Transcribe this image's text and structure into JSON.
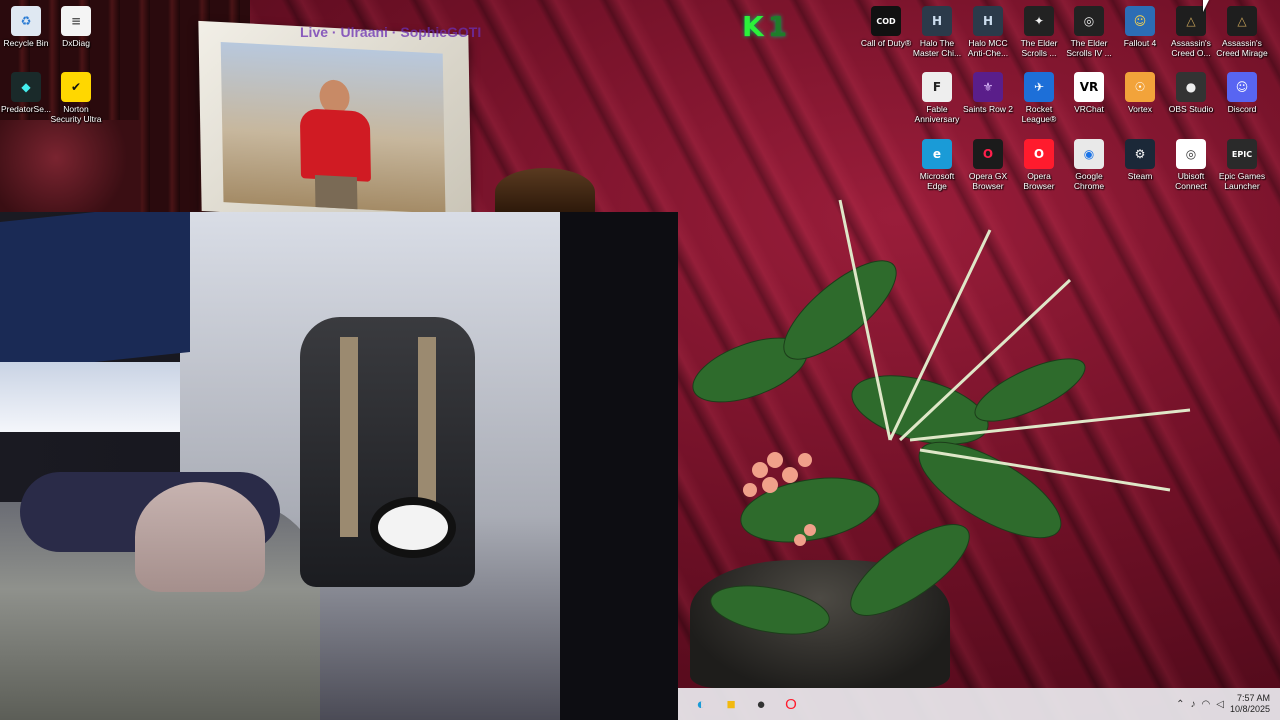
{
  "wallpaper": {
    "overlay_text": "Live · Ulraani · SophieGOTI",
    "logo": {
      "letter": "K",
      "suffix": "1",
      "color": "#2cf03a"
    },
    "colors": {
      "curtain": "#8a1733",
      "deep": "#3b0612"
    }
  },
  "desktop_icons": [
    {
      "label": "Recycle Bin",
      "icon": "recycle-bin-icon",
      "glyph": "♻",
      "bg": "#dfe8f2",
      "fg": "#2a7bd4"
    },
    {
      "label": "DxDiag",
      "icon": "document-icon",
      "glyph": "≡",
      "bg": "#f4f4f4",
      "fg": "#555"
    },
    {
      "label": "PredatorSe...",
      "icon": "predator-icon",
      "glyph": "◆",
      "bg": "#1a2a2a",
      "fg": "#4ee"
    },
    {
      "label": "Norton Security Ultra",
      "icon": "norton-icon",
      "glyph": "✔",
      "bg": "#ffd700",
      "fg": "#111"
    },
    {
      "label": "Call of Duty®",
      "icon": "call-of-duty-icon",
      "glyph": "COD",
      "bg": "#111",
      "fg": "#fff"
    },
    {
      "label": "Halo The Master Chi...",
      "icon": "halo-mcc-icon",
      "glyph": "H",
      "bg": "#2b3a4a",
      "fg": "#cde"
    },
    {
      "label": "Halo MCC Anti-Che...",
      "icon": "halo-anticheat-icon",
      "glyph": "H",
      "bg": "#2b3a4a",
      "fg": "#cde"
    },
    {
      "label": "The Elder Scrolls ...",
      "icon": "elder-scrolls-icon",
      "glyph": "✦",
      "bg": "#222",
      "fg": "#eee"
    },
    {
      "label": "The Elder Scrolls IV ...",
      "icon": "oblivion-icon",
      "glyph": "◎",
      "bg": "#222",
      "fg": "#eee"
    },
    {
      "label": "Fallout 4",
      "icon": "fallout-icon",
      "glyph": "☺",
      "bg": "#2c6db5",
      "fg": "#ffd64a"
    },
    {
      "label": "Assassin's Creed O...",
      "icon": "assassins-creed-icon",
      "glyph": "△",
      "bg": "#1e1e1e",
      "fg": "#c9a45a"
    },
    {
      "label": "Assassin's Creed Mirage",
      "icon": "assassins-creed-mirage-icon",
      "glyph": "△",
      "bg": "#1e1e1e",
      "fg": "#c9a45a"
    },
    {
      "label": "Fable Anniversary",
      "icon": "fable-icon",
      "glyph": "F",
      "bg": "#eee",
      "fg": "#222"
    },
    {
      "label": "Saints Row 2",
      "icon": "saints-row-icon",
      "glyph": "⚜",
      "bg": "#5a1e8a",
      "fg": "#e0c0ff"
    },
    {
      "label": "Rocket League®",
      "icon": "rocket-league-icon",
      "glyph": "✈",
      "bg": "#1d6fd8",
      "fg": "#fff"
    },
    {
      "label": "VRChat",
      "icon": "vrchat-icon",
      "glyph": "VR",
      "bg": "#fff",
      "fg": "#000"
    },
    {
      "label": "Vortex",
      "icon": "vortex-icon",
      "glyph": "☉",
      "bg": "#f2a33a",
      "fg": "#fff"
    },
    {
      "label": "OBS Studio",
      "icon": "obs-icon",
      "glyph": "●",
      "bg": "#333",
      "fg": "#eee"
    },
    {
      "label": "Discord",
      "icon": "discord-icon",
      "glyph": "☺",
      "bg": "#5865f2",
      "fg": "#fff"
    },
    {
      "label": "Microsoft Edge",
      "icon": "edge-icon",
      "glyph": "e",
      "bg": "#1a9bd7",
      "fg": "#fff"
    },
    {
      "label": "Opera GX Browser",
      "icon": "opera-gx-icon",
      "glyph": "O",
      "bg": "#1b1b1b",
      "fg": "#ff1f4b"
    },
    {
      "label": "Opera Browser",
      "icon": "opera-icon",
      "glyph": "O",
      "bg": "#ff1b2d",
      "fg": "#fff"
    },
    {
      "label": "Google Chrome",
      "icon": "chrome-icon",
      "glyph": "◉",
      "bg": "#e9e9e9",
      "fg": "#1a73e8"
    },
    {
      "label": "Steam",
      "icon": "steam-icon",
      "glyph": "⚙",
      "bg": "#1b2838",
      "fg": "#fff"
    },
    {
      "label": "Ubisoft Connect",
      "icon": "ubisoft-icon",
      "glyph": "◎",
      "bg": "#fff",
      "fg": "#333"
    },
    {
      "label": "Epic Games Launcher",
      "icon": "epic-games-icon",
      "glyph": "EPIC",
      "bg": "#2a2a2a",
      "fg": "#fff"
    }
  ],
  "taskbar": {
    "apps": [
      {
        "name": "edge",
        "glyph": "◐",
        "color": "#1a9bd7"
      },
      {
        "name": "file-explorer",
        "glyph": "■",
        "color": "#f2b90f"
      },
      {
        "name": "obs",
        "glyph": "●",
        "color": "#333"
      },
      {
        "name": "opera",
        "glyph": "O",
        "color": "#ff1b2d"
      }
    ],
    "tray": {
      "chevron": "⌃",
      "mic": "♪",
      "wifi": "◠",
      "volume": "◁",
      "time": "7:57 AM",
      "date": "10/8/2025"
    }
  }
}
